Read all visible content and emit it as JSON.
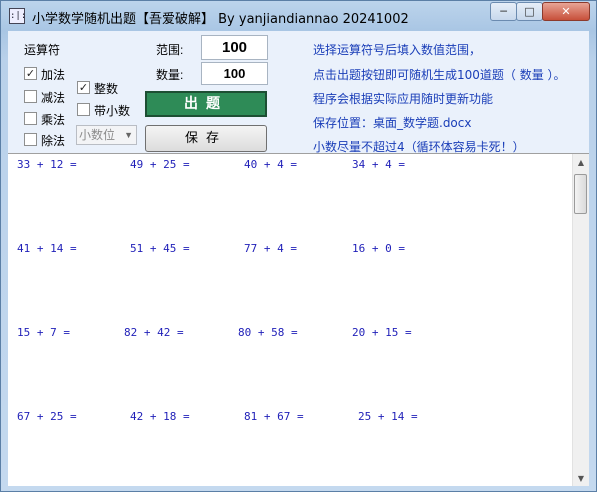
{
  "window": {
    "title": "小学数学随机出题【吾爱破解】 By yanjiandiannao 20241002",
    "icon": "app-icon",
    "minimize_glyph": "─",
    "maximize_glyph": "□",
    "close_glyph": "✕"
  },
  "controls": {
    "operator_label": "运算符",
    "ops": [
      {
        "label": "加法",
        "checked": true
      },
      {
        "label": "减法",
        "checked": false
      },
      {
        "label": "乘法",
        "checked": false
      },
      {
        "label": "除法",
        "checked": false
      }
    ],
    "types": [
      {
        "label": "整数",
        "checked": true
      },
      {
        "label": "带小数",
        "checked": false
      }
    ],
    "decimal_select": {
      "value": "小数位"
    },
    "range_label": "范围:",
    "range_value": "100",
    "count_label": "数量:",
    "count_value": "100",
    "generate_label": "出题",
    "save_label": "保存"
  },
  "info_lines": [
    "选择运算符号后填入数值范围，",
    "点击出题按钮即可随机生成100道题（ 数量 ）。",
    "程序会根据实际应用随时更新功能",
    "保存位置：桌面_数学题.docx",
    "小数尽量不超过4（循环体容易卡死！）"
  ],
  "problems": [
    [
      "33 + 12 =",
      "49 + 25 =",
      "40 + 4 =",
      "34 + 4 ="
    ],
    [
      "41 + 14 =",
      "51 + 45 =",
      "77 + 4 =",
      "16 + 0 ="
    ],
    [
      "15 + 7 =",
      "82 + 42 =",
      "80 + 58 =",
      "20 + 15 ="
    ],
    [
      "67 + 25 =",
      "42 + 18 =",
      "81 + 67 =",
      "25 + 14 ="
    ]
  ],
  "colors": {
    "generate_button": "#2e8b57",
    "info_text": "#1a3eb8",
    "problem_text": "#1f1fb8"
  }
}
